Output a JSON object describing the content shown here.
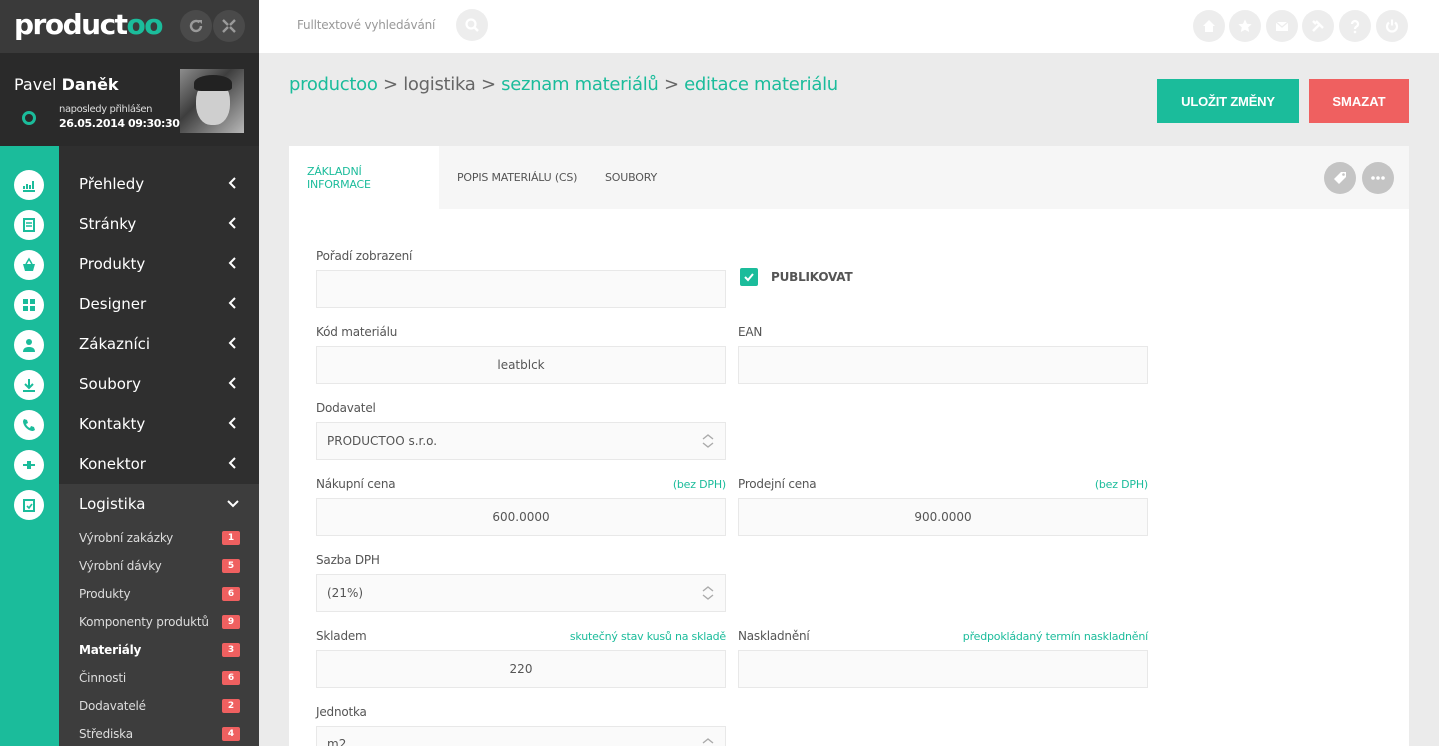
{
  "app": {
    "logo_main": "product",
    "logo_accent": "oo",
    "refresh_icon": "refresh-icon",
    "fullscreen_icon": "collapse-icon"
  },
  "user": {
    "first_name": "Pavel",
    "last_name": "Daněk",
    "last_login_label": "naposledy přihlášen",
    "last_login_date": "26.05.2014 09:30:30",
    "status_color": "#1bbc9b"
  },
  "menu": [
    {
      "label": "Přehledy",
      "icon": "chart-icon"
    },
    {
      "label": "Stránky",
      "icon": "pages-icon"
    },
    {
      "label": "Produkty",
      "icon": "basket-icon"
    },
    {
      "label": "Designer",
      "icon": "grid-icon"
    },
    {
      "label": "Zákazníci",
      "icon": "user-icon"
    },
    {
      "label": "Soubory",
      "icon": "download-icon"
    },
    {
      "label": "Kontakty",
      "icon": "phone-icon"
    },
    {
      "label": "Konektor",
      "icon": "connector-icon"
    },
    {
      "label": "Logistika",
      "icon": "clipboard-icon"
    }
  ],
  "submenu": [
    {
      "label": "Výrobní zakázky",
      "count": "1"
    },
    {
      "label": "Výrobní dávky",
      "count": "5"
    },
    {
      "label": "Produkty",
      "count": "6"
    },
    {
      "label": "Komponenty produktů",
      "count": "9"
    },
    {
      "label": "Materiály",
      "count": "3"
    },
    {
      "label": "Činnosti",
      "count": "6"
    },
    {
      "label": "Dodavatelé",
      "count": "2"
    },
    {
      "label": "Střediska",
      "count": "4"
    }
  ],
  "topbar": {
    "search_placeholder": "Fulltextové vyhledávání",
    "tools": [
      "home-icon",
      "star-icon",
      "mail-icon",
      "tools-icon",
      "help-icon",
      "power-icon"
    ]
  },
  "breadcrumb": {
    "part1": "productoo",
    "sep": ">",
    "part2": "logistika",
    "part3": "seznam materiálů",
    "part4": "editace materiálu"
  },
  "actions": {
    "save": "ULOŽIT ZMĚNY",
    "delete": "SMAZAT",
    "save_color": "#1bbc9b",
    "delete_color": "#ef6060"
  },
  "tabs": [
    {
      "label": "ZÁKLADNÍ INFORMACE",
      "active": true
    },
    {
      "label": "POPIS MATERIÁLU (CS)",
      "active": false
    },
    {
      "label": "SOUBORY",
      "active": false
    }
  ],
  "form": {
    "order_label": "Pořadí zobrazení",
    "order_value": "",
    "publish_label": "PUBLIKOVAT",
    "publish_checked": true,
    "code_label": "Kód materiálu",
    "code_value": "leatblck",
    "ean_label": "EAN",
    "ean_value": "",
    "supplier_label": "Dodavatel",
    "supplier_value": "PRODUCTOO s.r.o.",
    "buy_price_label": "Nákupní cena",
    "buy_price_hint": "(bez DPH)",
    "buy_price_value": "600.0000",
    "sell_price_label": "Prodejní cena",
    "sell_price_hint": "(bez DPH)",
    "sell_price_value": "900.0000",
    "vat_label": "Sazba DPH",
    "vat_value": "(21%)",
    "stock_label": "Skladem",
    "stock_hint": "skutečný stav kusů na skladě",
    "stock_value": "220",
    "restock_label": "Naskladnění",
    "restock_hint": "předpokládaný termín naskladnění",
    "restock_value": "",
    "unit_label": "Jednotka",
    "unit_value": "m2"
  }
}
